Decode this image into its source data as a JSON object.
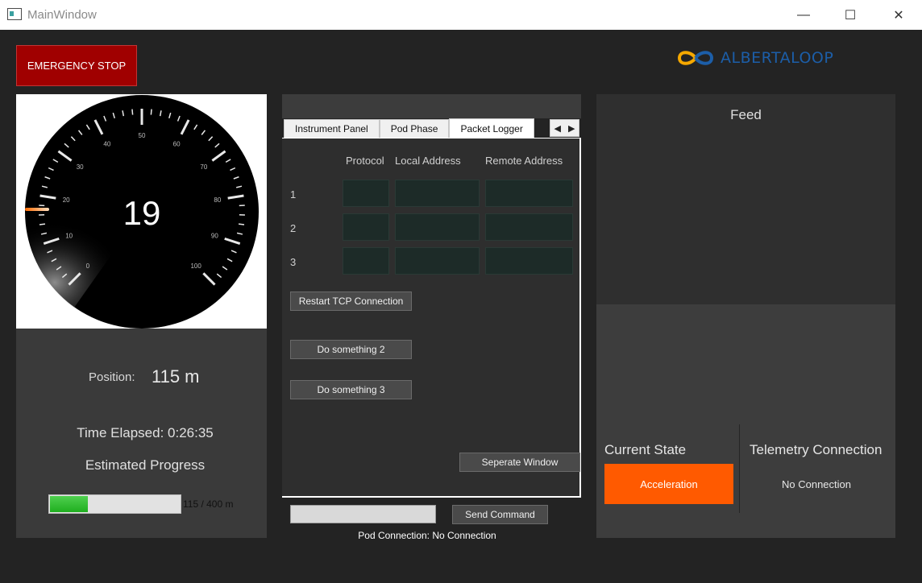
{
  "window": {
    "title": "MainWindow",
    "minimize_glyph": "—",
    "maximize_glyph": "☐",
    "close_glyph": "✕"
  },
  "emergency_stop": {
    "label": "EMERGENCY STOP",
    "color": "#a00000"
  },
  "logo": {
    "text": "ALBERTALOOP",
    "accent_colors": [
      "#f5a800",
      "#1c5ea8"
    ]
  },
  "gauge": {
    "value": "19",
    "min": 0,
    "max": 100,
    "tick_labels": [
      "0",
      "10",
      "20",
      "30",
      "40",
      "50",
      "60",
      "70",
      "80",
      "90",
      "100"
    ]
  },
  "position": {
    "label": "Position:",
    "value": "115 m"
  },
  "time_elapsed": "Time Elapsed: 0:26:35",
  "estimated_progress": {
    "label": "Estimated Progress",
    "current": 115,
    "total": 400,
    "text": "115 / 400 m",
    "bar_color": "#2fbf2f"
  },
  "tabs": [
    {
      "label": "Instrument Panel",
      "active": false
    },
    {
      "label": "Pod Phase",
      "active": false
    },
    {
      "label": "Packet Logger",
      "active": true
    }
  ],
  "tab_scroll": {
    "left_glyph": "◀",
    "right_glyph": "▶"
  },
  "packet_logger": {
    "columns": [
      "Protocol",
      "Local Address",
      "Remote Address"
    ],
    "rows": [
      {
        "label": "1",
        "protocol": "",
        "local": "",
        "remote": ""
      },
      {
        "label": "2",
        "protocol": "",
        "local": "",
        "remote": ""
      },
      {
        "label": "3",
        "protocol": "",
        "local": "",
        "remote": ""
      }
    ],
    "buttons": {
      "restart_tcp": "Restart TCP Connection",
      "do_something_2": "Do something 2",
      "do_something_3": "Do something 3",
      "separate_window": "Seperate Window"
    }
  },
  "command": {
    "input_value": "",
    "send_label": "Send Command"
  },
  "pod_connection": "Pod Connection: No Connection",
  "feed": {
    "label": "Feed"
  },
  "current_state": {
    "label": "Current State",
    "value": "Acceleration",
    "color": "#ff5a00"
  },
  "telemetry": {
    "label": "Telemetry Connection",
    "value": "No Connection"
  }
}
